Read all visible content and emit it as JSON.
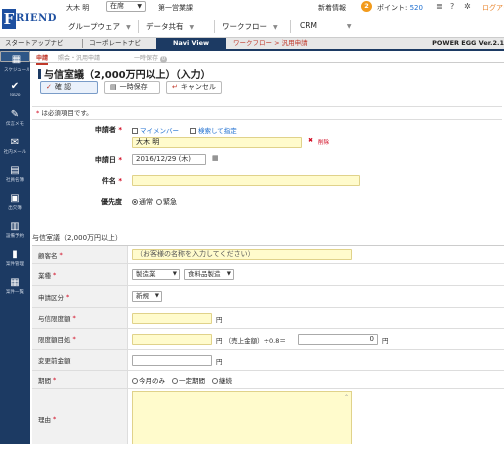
{
  "app": {
    "logo_f": "F",
    "logo_rest": "RIEND",
    "version": "POWER EGG Ver.2.1"
  },
  "topbar": {
    "user": "大木 明",
    "status": "在席",
    "dept": "第一営業課",
    "new_info_label": "新着情報",
    "new_info_count": "2",
    "points_label": "ポイント:",
    "points_value": "520",
    "logout": "ログアウト"
  },
  "main_nav": [
    {
      "label": "グループウェア"
    },
    {
      "label": "データ共有"
    },
    {
      "label": "ワークフロー"
    },
    {
      "label": "CRM"
    }
  ],
  "tabs": [
    {
      "label": "スタートアップナビ"
    },
    {
      "label": "コーポレートナビ"
    },
    {
      "label": "Navi View"
    },
    {
      "label": "ワークフロー > 汎用申請"
    }
  ],
  "sidebar": [
    {
      "label": "スケジュール",
      "icon": "calendar-icon"
    },
    {
      "label": "ToDo",
      "icon": "check-icon"
    },
    {
      "label": "伝言メモ",
      "icon": "memo-icon"
    },
    {
      "label": "社内メール",
      "icon": "mail-icon"
    },
    {
      "label": "社員名簿",
      "icon": "address-book-icon"
    },
    {
      "label": "出欠簿",
      "icon": "attendance-icon"
    },
    {
      "label": "設備予約",
      "icon": "equipment-icon"
    },
    {
      "label": "案件管理",
      "icon": "project-icon"
    },
    {
      "label": "案件一覧",
      "icon": "table-icon"
    }
  ],
  "subtabs": {
    "apply": "申請",
    "inquiry": "照会・汎用申請",
    "temp": "一時保存",
    "temp_count": "0"
  },
  "page": {
    "title": "与信室議（2,000万円以上）（入力）"
  },
  "buttons": {
    "confirm": "確 認",
    "save": "一時保存",
    "cancel": "キャンセル"
  },
  "required_note": "は必須項目です。",
  "form": {
    "applicant_label": "申請者",
    "my_member_link": "マイメンバー",
    "search_link": "検索して指定",
    "applicant_value": "大木 明",
    "delete_label": "削除",
    "date_label": "申請日",
    "date_value": "2016/12/29 (木)",
    "subject_label": "件名",
    "subject_value": "",
    "priority_label": "優先度",
    "priority_normal": "通常",
    "priority_urgent": "緊急"
  },
  "section": {
    "title": "与信室議（2,000万円以上）"
  },
  "detail": {
    "customer_label": "顧客名",
    "customer_placeholder": "（お客様の名称を入力してください）",
    "industry_label": "業種",
    "industry_value": "製造業",
    "industry_sub_value": "食料品製造",
    "apply_type_label": "申請区分",
    "apply_type_value": "新規",
    "credit_limit_label": "与信限度額",
    "yen": "円",
    "limit_guide_label": "限度額目処",
    "sales_formula": "円 （売上金額）÷0.8＝",
    "limit_guide_result": "0",
    "prev_amount_label": "変更前金額",
    "period_label": "期間",
    "period_opt1": "今月のみ",
    "period_opt2": "一定期間",
    "period_opt3": "継続",
    "reason_label": "理由"
  }
}
